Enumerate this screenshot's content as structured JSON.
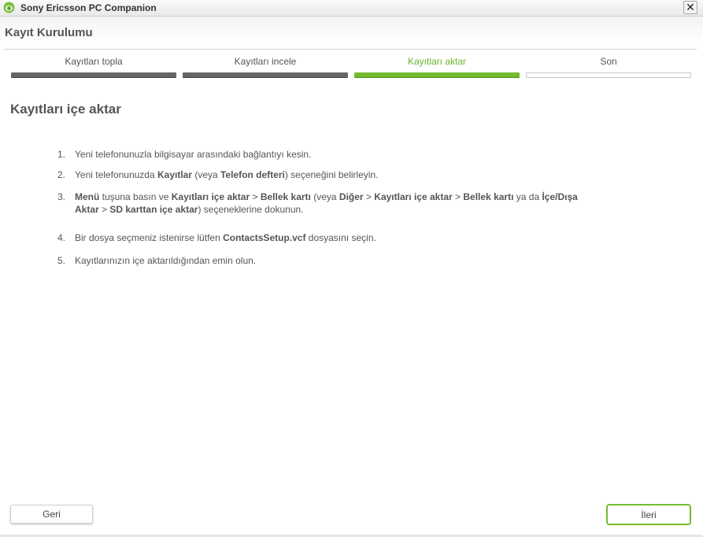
{
  "window": {
    "title": "Sony Ericsson PC Companion",
    "close_glyph": "✕",
    "icon": "sony-ericsson-logo-icon"
  },
  "page_title": "Kayıt Kurulumu",
  "steps": [
    {
      "label": "Kayıtları topla",
      "state": "done"
    },
    {
      "label": "Kayıtları incele",
      "state": "done"
    },
    {
      "label": "Kayıtları aktar",
      "state": "active"
    },
    {
      "label": "Son",
      "state": "todo"
    }
  ],
  "colors": {
    "accent": "#74bb2f",
    "done_bar": "#666666",
    "text": "#555555"
  },
  "section_title": "Kayıtları içe aktar",
  "instructions": [
    {
      "num": "1.",
      "parts": [
        {
          "t": " Yeni telefonunuzla bilgisayar arasındaki bağlantıyı kesin.",
          "b": false
        }
      ]
    },
    {
      "num": "2.",
      "parts": [
        {
          "t": "Yeni telefonunuzda ",
          "b": false
        },
        {
          "t": "Kayıtlar",
          "b": true
        },
        {
          "t": " (veya ",
          "b": false
        },
        {
          "t": "Telefon defteri",
          "b": true
        },
        {
          "t": ") seçeneğini belirleyin.",
          "b": false
        }
      ]
    },
    {
      "num": "3.",
      "parts": [
        {
          "t": "Menü",
          "b": true
        },
        {
          "t": " tuşuna basın ve ",
          "b": false
        },
        {
          "t": "Kayıtları içe aktar",
          "b": true
        },
        {
          "t": " > ",
          "b": false
        },
        {
          "t": "Bellek kartı",
          "b": true
        },
        {
          "t": " (veya ",
          "b": false
        },
        {
          "t": "Diğer",
          "b": true
        },
        {
          "t": " > ",
          "b": false
        },
        {
          "t": "Kayıtları içe aktar",
          "b": true
        },
        {
          "t": " > ",
          "b": false
        },
        {
          "t": "Bellek kartı",
          "b": true
        },
        {
          "t": " ya da ",
          "b": false
        },
        {
          "t": "İçe/Dışa Aktar",
          "b": true
        },
        {
          "t": " > ",
          "b": false
        },
        {
          "t": "SD karttan içe aktar",
          "b": true
        },
        {
          "t": ") seçeneklerine dokunun.",
          "b": false
        }
      ]
    },
    {
      "num": "4.",
      "parts": [
        {
          "t": "Bir dosya seçmeniz istenirse lütfen ",
          "b": false
        },
        {
          "t": "ContactsSetup.vcf",
          "b": true
        },
        {
          "t": " dosyasını seçin.",
          "b": false
        }
      ]
    },
    {
      "num": "5.",
      "parts": [
        {
          "t": "Kayıtlarınızın içe aktarıldığından emin olun.",
          "b": false
        }
      ]
    }
  ],
  "buttons": {
    "back": "Geri",
    "next": "İleri"
  }
}
